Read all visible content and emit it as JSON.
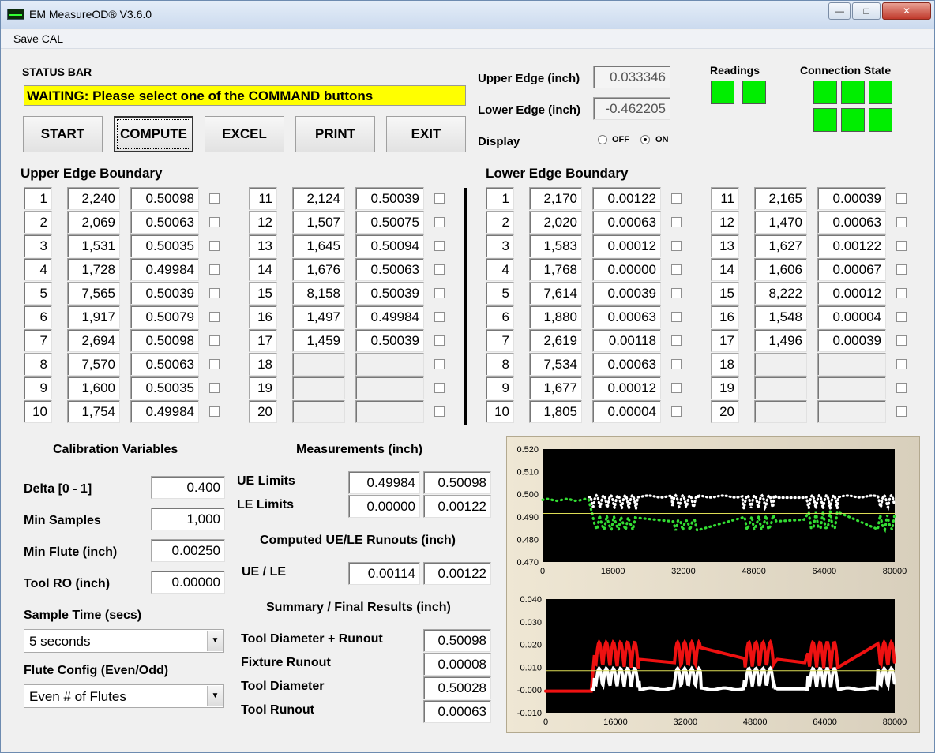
{
  "window": {
    "title": "EM MeasureOD® V3.6.0"
  },
  "menu": {
    "save_cal": "Save CAL"
  },
  "status": {
    "label": "STATUS BAR",
    "text": "WAITING: Please select one of the COMMAND buttons"
  },
  "commands": [
    {
      "label": "START"
    },
    {
      "label": "COMPUTE"
    },
    {
      "label": "EXCEL"
    },
    {
      "label": "PRINT"
    },
    {
      "label": "EXIT"
    }
  ],
  "edges": {
    "upper_label": "Upper Edge (inch)",
    "upper_value": "0.033346",
    "lower_label": "Lower Edge (inch)",
    "lower_value": "-0.462205",
    "display_label": "Display",
    "off_label": "OFF",
    "on_label": "ON",
    "display_state": "ON"
  },
  "readings": {
    "label": "Readings",
    "leds": 2,
    "color": "#00ee00"
  },
  "connection": {
    "label": "Connection State",
    "leds": 6,
    "color": "#00ee00"
  },
  "upper_boundary": {
    "label": "Upper Edge Boundary",
    "rows": [
      {
        "n": "1",
        "count": "2,240",
        "value": "0.50098"
      },
      {
        "n": "2",
        "count": "2,069",
        "value": "0.50063"
      },
      {
        "n": "3",
        "count": "1,531",
        "value": "0.50035"
      },
      {
        "n": "4",
        "count": "1,728",
        "value": "0.49984"
      },
      {
        "n": "5",
        "count": "7,565",
        "value": "0.50039"
      },
      {
        "n": "6",
        "count": "1,917",
        "value": "0.50079"
      },
      {
        "n": "7",
        "count": "2,694",
        "value": "0.50098"
      },
      {
        "n": "8",
        "count": "7,570",
        "value": "0.50063"
      },
      {
        "n": "9",
        "count": "1,600",
        "value": "0.50035"
      },
      {
        "n": "10",
        "count": "1,754",
        "value": "0.49984"
      },
      {
        "n": "11",
        "count": "2,124",
        "value": "0.50039"
      },
      {
        "n": "12",
        "count": "1,507",
        "value": "0.50075"
      },
      {
        "n": "13",
        "count": "1,645",
        "value": "0.50094"
      },
      {
        "n": "14",
        "count": "1,676",
        "value": "0.50063"
      },
      {
        "n": "15",
        "count": "8,158",
        "value": "0.50039"
      },
      {
        "n": "16",
        "count": "1,497",
        "value": "0.49984"
      },
      {
        "n": "17",
        "count": "1,459",
        "value": "0.50039"
      },
      {
        "n": "18",
        "count": "",
        "value": ""
      },
      {
        "n": "19",
        "count": "",
        "value": ""
      },
      {
        "n": "20",
        "count": "",
        "value": ""
      }
    ]
  },
  "lower_boundary": {
    "label": "Lower Edge Boundary",
    "rows": [
      {
        "n": "1",
        "count": "2,170",
        "value": "0.00122"
      },
      {
        "n": "2",
        "count": "2,020",
        "value": "0.00063"
      },
      {
        "n": "3",
        "count": "1,583",
        "value": "0.00012"
      },
      {
        "n": "4",
        "count": "1,768",
        "value": "0.00000"
      },
      {
        "n": "5",
        "count": "7,614",
        "value": "0.00039"
      },
      {
        "n": "6",
        "count": "1,880",
        "value": "0.00063"
      },
      {
        "n": "7",
        "count": "2,619",
        "value": "0.00118"
      },
      {
        "n": "8",
        "count": "7,534",
        "value": "0.00063"
      },
      {
        "n": "9",
        "count": "1,677",
        "value": "0.00012"
      },
      {
        "n": "10",
        "count": "1,805",
        "value": "0.00004"
      },
      {
        "n": "11",
        "count": "2,165",
        "value": "0.00039"
      },
      {
        "n": "12",
        "count": "1,470",
        "value": "0.00063"
      },
      {
        "n": "13",
        "count": "1,627",
        "value": "0.00122"
      },
      {
        "n": "14",
        "count": "1,606",
        "value": "0.00067"
      },
      {
        "n": "15",
        "count": "8,222",
        "value": "0.00012"
      },
      {
        "n": "16",
        "count": "1,548",
        "value": "0.00004"
      },
      {
        "n": "17",
        "count": "1,496",
        "value": "0.00039"
      },
      {
        "n": "18",
        "count": "",
        "value": ""
      },
      {
        "n": "19",
        "count": "",
        "value": ""
      },
      {
        "n": "20",
        "count": "",
        "value": ""
      }
    ]
  },
  "calibration": {
    "label": "Calibration Variables",
    "fields": [
      {
        "label": "Delta [0 - 1]",
        "value": "0.400"
      },
      {
        "label": "Min Samples",
        "value": "1,000"
      },
      {
        "label": "Min Flute (inch)",
        "value": "0.00250"
      },
      {
        "label": "Tool RO (inch)",
        "value": "0.00000"
      }
    ],
    "sample_time_label": "Sample Time (secs)",
    "sample_time_value": "5 seconds",
    "flute_label": "Flute Config (Even/Odd)",
    "flute_value": "Even # of Flutes"
  },
  "measurements": {
    "label": "Measurements (inch)",
    "ue_label": "UE Limits",
    "ue_min": "0.49984",
    "ue_max": "0.50098",
    "le_label": "LE Limits",
    "le_min": "0.00000",
    "le_max": "0.00122",
    "computed_label": "Computed UE/LE Runouts (inch)",
    "uele_label": "UE / LE",
    "ue_runout": "0.00114",
    "le_runout": "0.00122"
  },
  "summary": {
    "label": "Summary / Final Results (inch)",
    "rows": [
      {
        "label": "Tool Diameter + Runout",
        "value": "0.50098"
      },
      {
        "label": "Fixture Runout",
        "value": "0.00008"
      },
      {
        "label": "Tool Diameter",
        "value": "0.50028"
      },
      {
        "label": "Tool Runout",
        "value": "0.00063"
      }
    ]
  },
  "chart_data": [
    {
      "type": "scatter",
      "ylim": [
        0.47,
        0.52
      ],
      "yticks": [
        "0.520",
        "0.510",
        "0.500",
        "0.490",
        "0.480",
        "0.470"
      ],
      "xlim": [
        0,
        80000
      ],
      "xticks": [
        "0",
        "16000",
        "32000",
        "48000",
        "64000",
        "80000"
      ],
      "reference_line": 0.4915,
      "colors": {
        "bg": "#000000",
        "primary": "#ffffff",
        "secondary": "#33dd33",
        "ref": "#dddd55"
      },
      "grid": false
    },
    {
      "type": "scatter",
      "ylim": [
        -0.01,
        0.04
      ],
      "yticks": [
        "0.040",
        "0.030",
        "0.020",
        "0.010",
        "-0.000",
        "-0.010"
      ],
      "xlim": [
        0,
        80000
      ],
      "xticks": [
        "0",
        "16000",
        "32000",
        "48000",
        "64000",
        "80000"
      ],
      "reference_line": 0.0085,
      "colors": {
        "bg": "#000000",
        "primary": "#ffffff",
        "secondary": "#ee1111",
        "ref": "#dddd55"
      },
      "grid": false
    }
  ]
}
